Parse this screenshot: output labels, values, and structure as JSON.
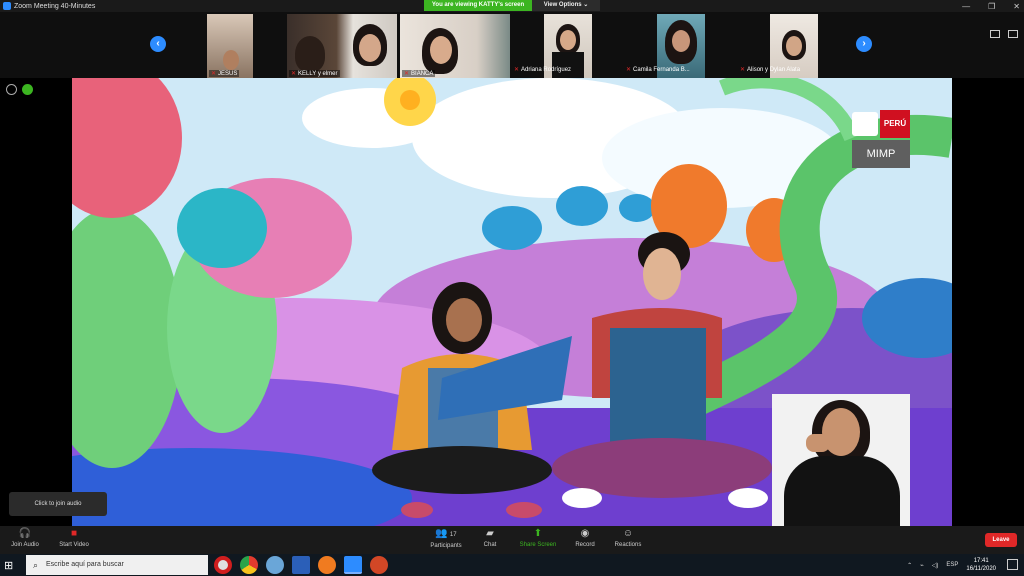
{
  "window": {
    "title": "Zoom Meeting 40-Minutes",
    "viewing_banner": "You are viewing KATTY's screen",
    "view_options": "View Options ⌄",
    "controls": [
      "—",
      "❐",
      "✕"
    ]
  },
  "participants": [
    {
      "name": "JESUS",
      "muted": true
    },
    {
      "name": "KELLY y elmer",
      "muted": true
    },
    {
      "name": "BIANCA",
      "muted": true
    },
    {
      "name": "Adriana Rodríguez",
      "muted": true
    },
    {
      "name": "Camila Fernanda B...",
      "muted": true
    },
    {
      "name": "Alison y Dylan Alata",
      "muted": true
    }
  ],
  "stage": {
    "logo_country": "PERÚ",
    "logo_org": "MIMP"
  },
  "toolbar": {
    "tooltip": "Click to join audio",
    "join_audio": "Join Audio",
    "start_video": "Start Video",
    "participants": "Participants",
    "participants_count": "17",
    "chat": "Chat",
    "share_screen": "Share Screen",
    "record": "Record",
    "reactions": "Reactions",
    "leave": "Leave"
  },
  "taskbar": {
    "search_placeholder": "Escribe aquí para buscar",
    "language": "ESP",
    "time": "17:41",
    "date": "16/11/2020"
  }
}
